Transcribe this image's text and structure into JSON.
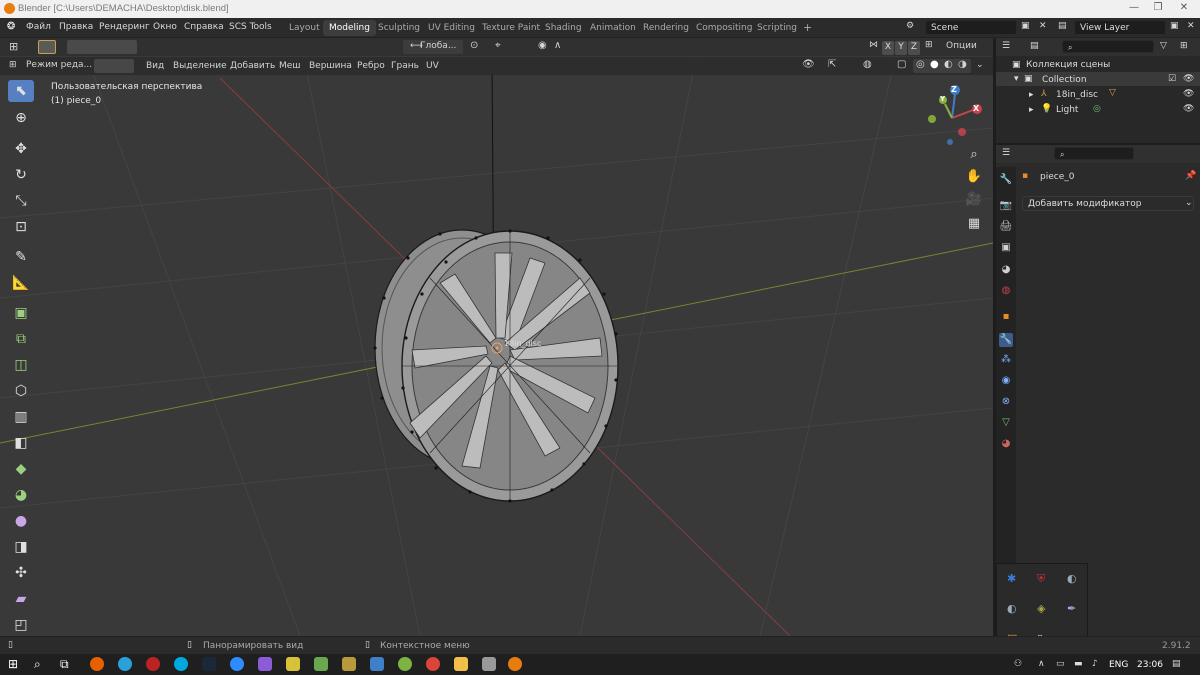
{
  "window": {
    "title": "Blender [C:\\Users\\DEMACHA\\Desktop\\disk.blend]",
    "minimize": "—",
    "maximize": "❐",
    "close": "✕"
  },
  "menu": [
    "Файл",
    "Правка",
    "Рендеринг",
    "Окно",
    "Справка",
    "SCS Tools"
  ],
  "workspaces": [
    {
      "label": "Layout",
      "active": false
    },
    {
      "label": "Modeling",
      "active": true
    },
    {
      "label": "Sculpting",
      "active": false
    },
    {
      "label": "UV Editing",
      "active": false
    },
    {
      "label": "Texture Paint",
      "active": false
    },
    {
      "label": "Shading",
      "active": false
    },
    {
      "label": "Animation",
      "active": false
    },
    {
      "label": "Rendering",
      "active": false
    },
    {
      "label": "Compositing",
      "active": false
    },
    {
      "label": "Scripting",
      "active": false
    }
  ],
  "add_workspace": "+",
  "scene": {
    "name": "Scene",
    "view_layer": "View Layer"
  },
  "viewport_header": {
    "transform_orientation": "Глоба...",
    "axes": [
      "X",
      "Y",
      "Z"
    ],
    "options": "Опции",
    "mode": "Режим реда...",
    "menus": [
      "Вид",
      "Выделение",
      "Добавить",
      "Меш",
      "Вершина",
      "Ребро",
      "Грань",
      "UV"
    ]
  },
  "overlay_text": {
    "view_name": "Пользовательская перспектива",
    "object": "(1) piece_0",
    "object_label": "18in_disc"
  },
  "gizmo": {
    "x": "X",
    "y": "Y",
    "z": "Z"
  },
  "outliner": {
    "root": "Коллекция сцены",
    "collection": "Collection",
    "items": [
      {
        "name": "18in_disc"
      },
      {
        "name": "Light"
      }
    ]
  },
  "properties": {
    "object_name": "piece_0",
    "add_modifier": "Добавить модификатор"
  },
  "statusbar": {
    "pan": "Панорамировать вид",
    "context": "Контекстное меню",
    "version": "2.91.2"
  },
  "taskbar": {
    "lang": "ENG",
    "time": "23:06"
  },
  "colors": {
    "accent": "#5680c2",
    "axis_x": "#c6454e",
    "axis_y": "#8ab13c",
    "axis_z": "#3f7ec8",
    "blender_orange": "#e87d0d"
  }
}
